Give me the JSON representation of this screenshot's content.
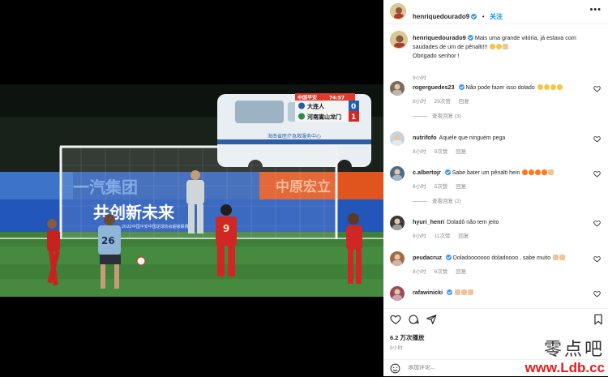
{
  "header": {
    "username": "henriquedourado9",
    "separator": "•",
    "follow_label": "关注",
    "more_icon": "more-horizontal-icon"
  },
  "scoreboard": {
    "brand": "中国平安",
    "clock": "74:57",
    "team1": "大连人",
    "score1": "0",
    "team2": "河南嵩山龙门",
    "score2": "1"
  },
  "stadium": {
    "banner1": "一汽集团",
    "banner2": "共创新未来",
    "banner3": "中原宏立",
    "ad_small": "2022中国平安中国足球协会超级联赛",
    "van_text": "海南省医疗急救服务中心",
    "player_number_blue": "26",
    "player_number_red": "9"
  },
  "caption": {
    "username": "henriquedourado9",
    "text1": "Mais uma grande vitória, já estava com saudades de um de pênalti!!!",
    "text2": "Obrigado senhor !",
    "time": "9小时"
  },
  "comments": [
    {
      "username": "rogerguedes23",
      "verified": true,
      "text": "Não pode fazer isso dolado",
      "emojis": [
        "y",
        "y",
        "y",
        "y"
      ],
      "time": "8小时",
      "likes": "29次赞",
      "reply": "回复",
      "view_replies": "查看回复 (3)"
    },
    {
      "username": "nutrifofo",
      "verified": false,
      "text": "Aquele que ninguém pega",
      "emojis": [],
      "time": "8小时",
      "likes": "9次赞",
      "reply": "回复",
      "view_replies": ""
    },
    {
      "username": "c.albertojr",
      "verified": true,
      "text": "Sabe bater um pênalti hein",
      "emojis": [
        "f",
        "f",
        "f",
        "f",
        "h"
      ],
      "time": "8小时",
      "likes": "5次赞",
      "reply": "回复",
      "view_replies": "查看回复 (2)"
    },
    {
      "username": "hyuri_henri",
      "verified": false,
      "text": "Doladô não tem jeito",
      "emojis": [],
      "time": "8小时",
      "likes": "11次赞",
      "reply": "回复",
      "view_replies": ""
    },
    {
      "username": "peudacruz",
      "verified": true,
      "text": "Doladooooooo doladoooo , sabe muito",
      "emojis": [
        "h",
        "h"
      ],
      "time": "8小时",
      "likes": "6次赞",
      "reply": "回复",
      "view_replies": ""
    },
    {
      "username": "rafawinicki",
      "verified": true,
      "text": "",
      "emojis": [
        "h",
        "h",
        "h"
      ],
      "time": "",
      "likes": "",
      "reply": "",
      "view_replies": ""
    }
  ],
  "footer": {
    "views": "6.2 万次播放",
    "time": "9小时",
    "add_comment_placeholder": "添加评论..."
  },
  "watermark": {
    "cn": "零点吧",
    "url": "www.Ldb.cc"
  },
  "colors": {
    "accent": "#0095f6",
    "verified": "#3897f0",
    "pitch": "#3f7f3a",
    "watermark_red": "#e11d1d"
  }
}
